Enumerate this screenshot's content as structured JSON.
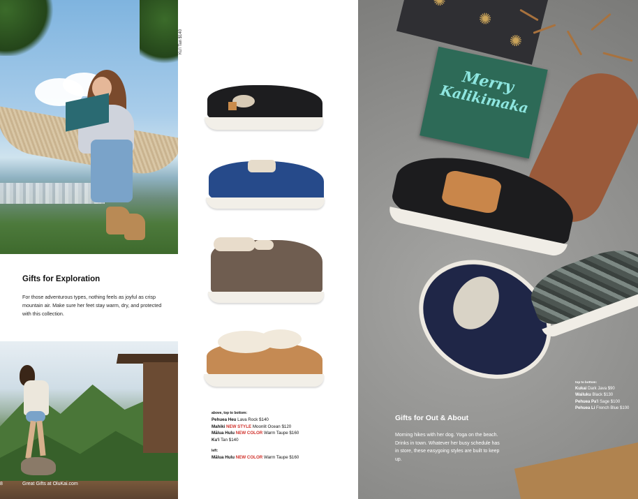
{
  "left": {
    "section_title": "Gifts for Exploration",
    "section_body": "For those adventurous types, nothing feels as joyful as crisp mountain air. Make sure her feet stay warm, dry, and protected with this collection.",
    "spine_label": "Ku'i Tan $140",
    "page_number": "8",
    "footer_text": "Great Gifts at OluKai.com"
  },
  "shoes_caption": {
    "heading": "above, top to bottom:",
    "lines": [
      {
        "name": "Pehuea Heu",
        "badge": "",
        "detail": "Lava Rock $140"
      },
      {
        "name": "Mahiki",
        "badge": "NEW STYLE",
        "detail": "Moonlit Ocean $120"
      },
      {
        "name": "Mālua Hulu",
        "badge": "NEW COLOR",
        "detail": "Warm Taupe $160"
      },
      {
        "name": "Ku'i",
        "badge": "",
        "detail": "Tan $140"
      }
    ],
    "left_heading": "left:",
    "left_line": {
      "name": "Mālua Hulu",
      "badge": "NEW COLOR",
      "detail": "Warm Taupe $160"
    }
  },
  "right": {
    "card_text_1": "Merry",
    "card_text_2": "Kalikimaka",
    "section_title": "Gifts for Out & About",
    "section_body": "Morning hikes with her dog. Yoga on the beach. Drinks in town. Whatever her busy schedule has in store, these easygoing styles are built to keep up.",
    "caption_heading": "top to bottom:",
    "caption_lines": [
      {
        "name": "Kukai",
        "detail": "Dark Java $90"
      },
      {
        "name": "Wailuku",
        "detail": "Black $130"
      },
      {
        "name": "Pehuea Pa'i",
        "detail": "Sage $100"
      },
      {
        "name": "Pehuea Li",
        "detail": "French Blue $100"
      }
    ]
  },
  "colors": {
    "badge_red": "#d0302a",
    "card_green": "#2d6a57",
    "card_script": "#8ee6e0"
  }
}
